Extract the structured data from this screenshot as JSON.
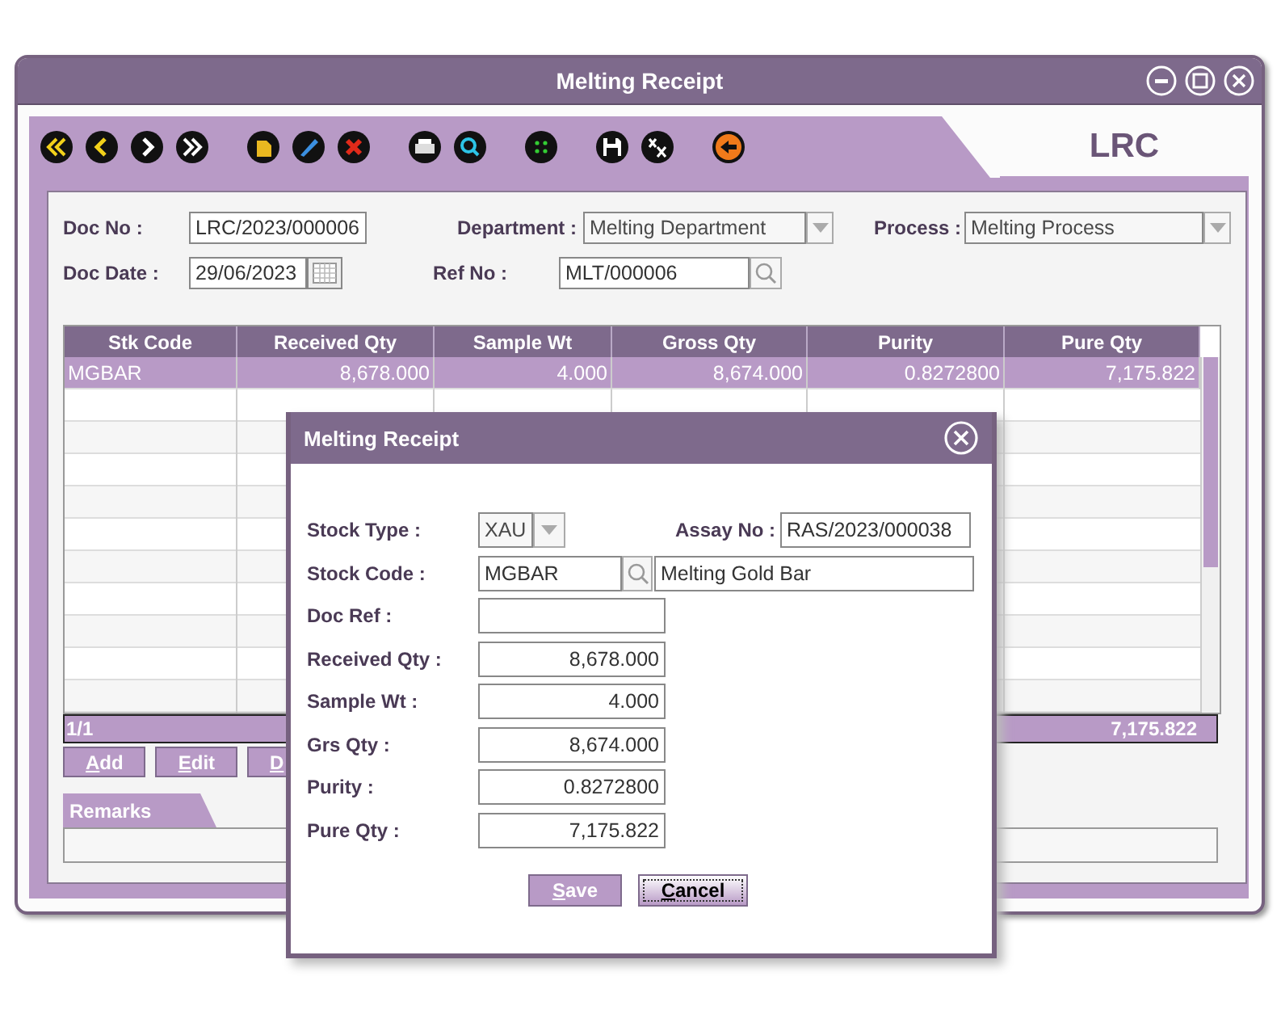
{
  "window": {
    "title": "Melting Receipt",
    "tab": "LRC"
  },
  "toolbar": [
    {
      "kind": "first"
    },
    {
      "kind": "prev"
    },
    {
      "kind": "next"
    },
    {
      "kind": "last"
    },
    {
      "kind": "gap"
    },
    {
      "kind": "new"
    },
    {
      "kind": "edit"
    },
    {
      "kind": "delete"
    },
    {
      "kind": "gap"
    },
    {
      "kind": "print"
    },
    {
      "kind": "search"
    },
    {
      "kind": "gap"
    },
    {
      "kind": "dots"
    },
    {
      "kind": "gap"
    },
    {
      "kind": "save"
    },
    {
      "kind": "clear"
    },
    {
      "kind": "gap"
    },
    {
      "kind": "exit"
    }
  ],
  "form": {
    "doc_no": {
      "label": "Doc No :",
      "value": "LRC/2023/000006"
    },
    "doc_date": {
      "label": "Doc Date :",
      "value": "29/06/2023"
    },
    "department": {
      "label": "Department :",
      "value": "Melting Department"
    },
    "ref_no": {
      "label": "Ref No :",
      "value": "MLT/000006"
    },
    "process": {
      "label": "Process :",
      "value": "Melting Process"
    }
  },
  "grid": {
    "columns": [
      "Stk Code",
      "Received Qty",
      "Sample Wt",
      "Gross Qty",
      "Purity",
      "Pure Qty"
    ],
    "rows": [
      {
        "cells": [
          "MGBAR",
          "8,678.000",
          "4.000",
          "8,674.000",
          "0.8272800",
          "7,175.822"
        ],
        "selected": true
      }
    ],
    "footer": {
      "count": "1/1",
      "total": "7,175.822"
    }
  },
  "grid_buttons": [
    "Add",
    "Edit",
    "D"
  ],
  "remarks": {
    "label": "Remarks"
  },
  "dialog": {
    "title": "Melting Receipt",
    "stock_type": {
      "label": "Stock Type :",
      "value": "XAU"
    },
    "assay_no": {
      "label": "Assay No :",
      "value": "RAS/2023/000038"
    },
    "stock_code": {
      "label": "Stock Code :",
      "value": "MGBAR",
      "description": "Melting Gold Bar"
    },
    "fields": [
      {
        "label": "Doc Ref :"
      },
      {
        "label": "Received Qty :",
        "value": "8,678.000"
      },
      {
        "label": "Sample Wt :",
        "value": "4.000"
      },
      {
        "label": "Grs Qty :",
        "value": "8,674.000"
      },
      {
        "label": "Purity :",
        "value": "0.8272800"
      },
      {
        "label": "Pure Qty :",
        "value": "7,175.822"
      }
    ],
    "buttons": [
      {
        "label": "Save",
        "kind": "normal"
      },
      {
        "label": "Cancel",
        "kind": "focused"
      }
    ]
  }
}
